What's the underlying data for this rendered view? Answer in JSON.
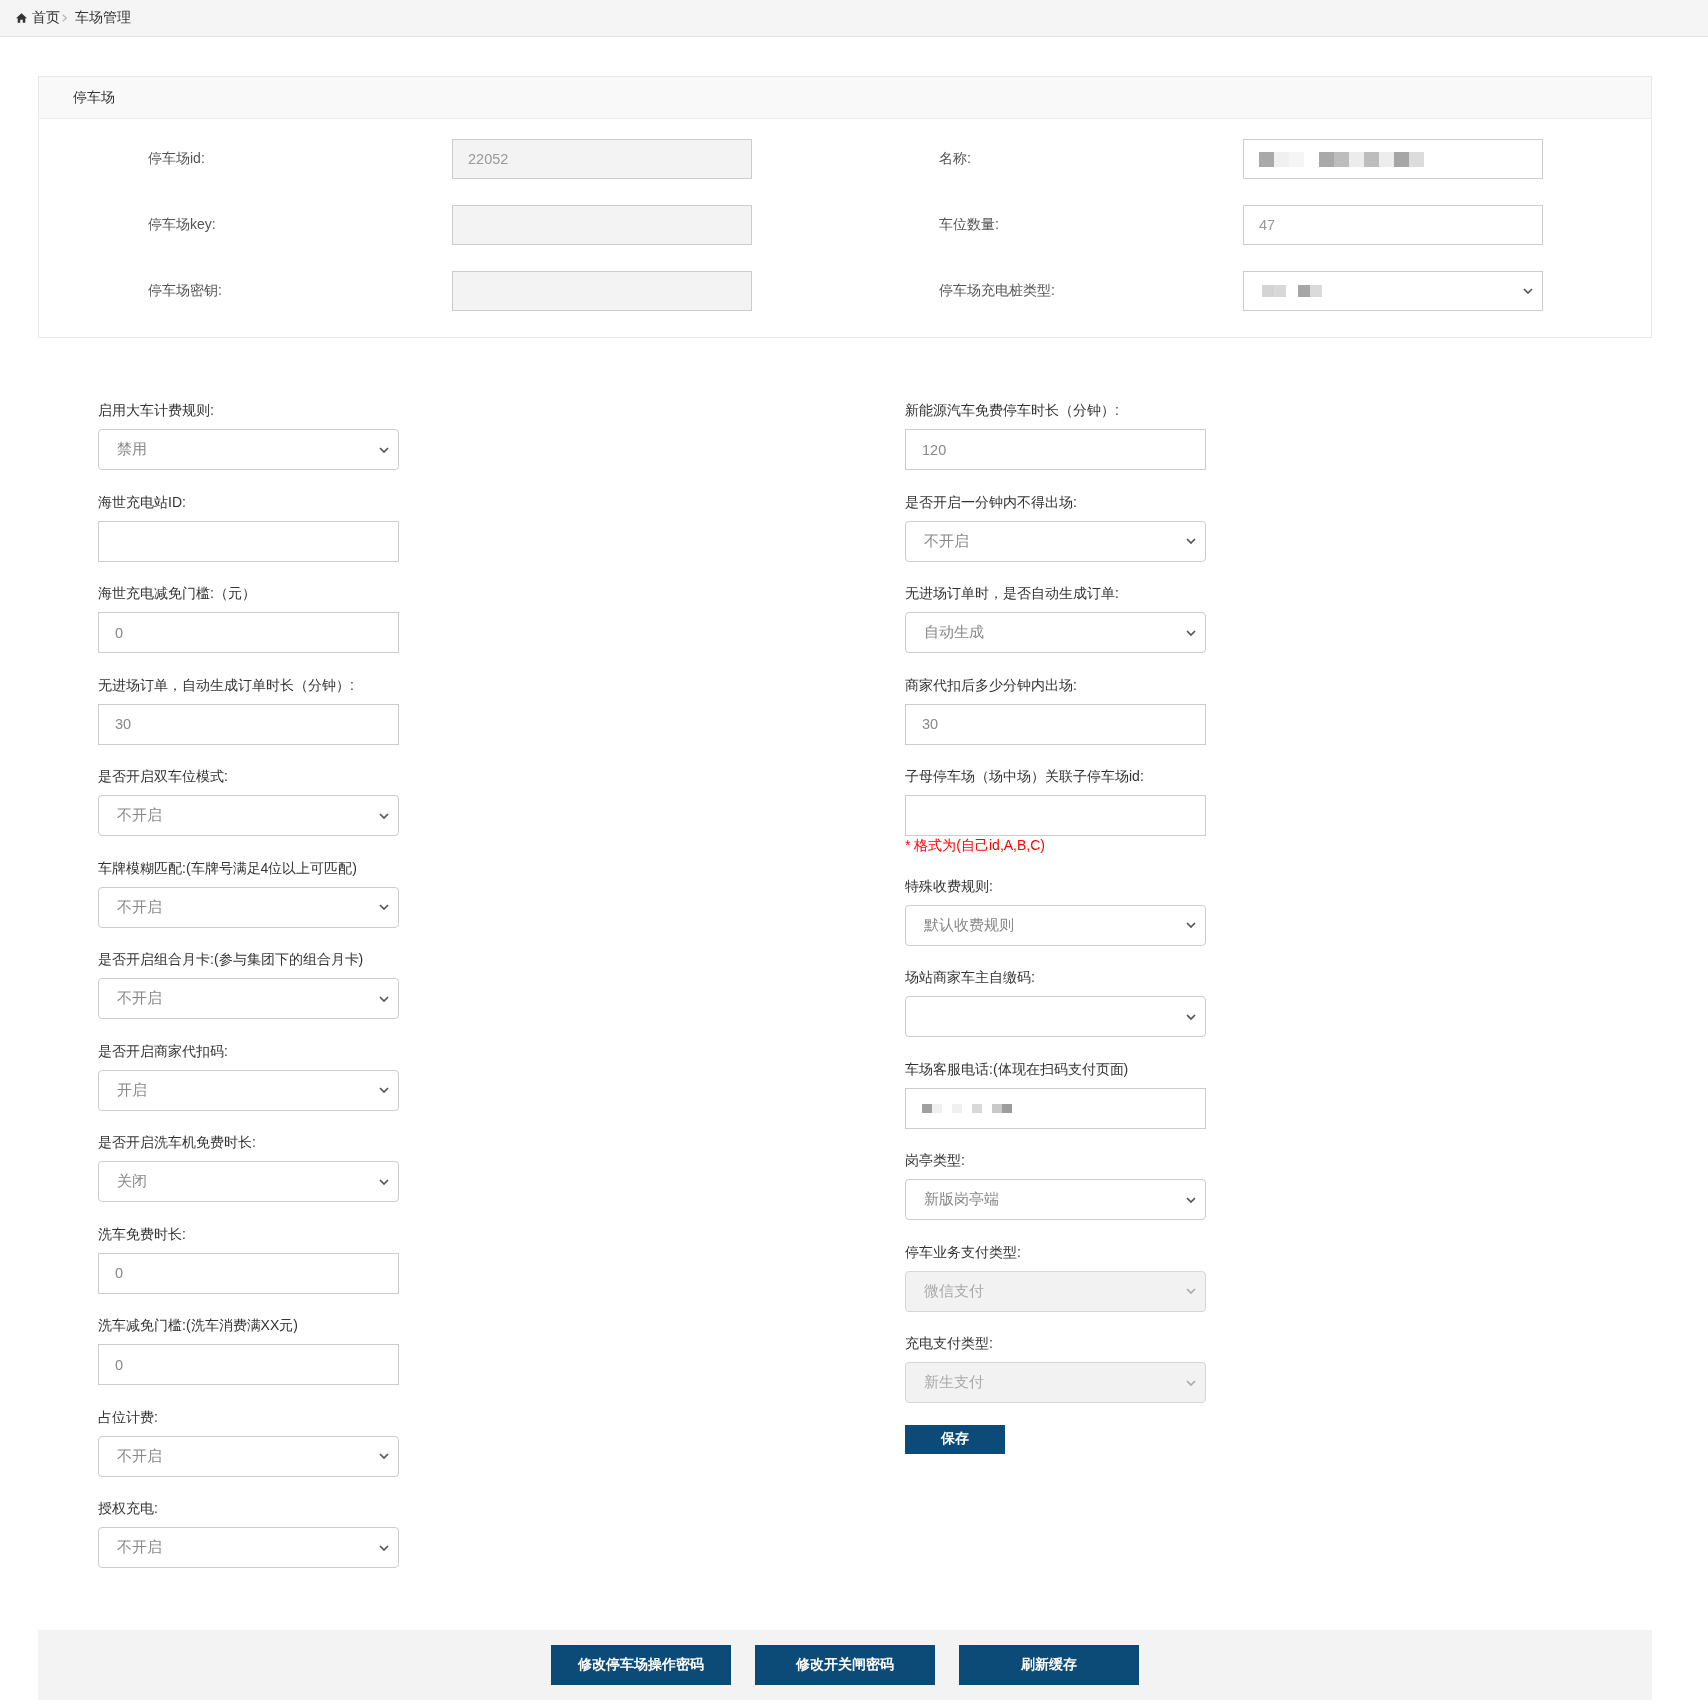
{
  "breadcrumb": {
    "items": [
      {
        "label": "首页",
        "kind": "home"
      },
      {
        "label": "车场管理",
        "kind": "page"
      }
    ]
  },
  "panel": {
    "title": "停车场",
    "fields": [
      {
        "label": "停车场id:",
        "kind": "input",
        "value": "22052",
        "disabled": true,
        "redacted": false
      },
      {
        "label": "名称:",
        "kind": "input",
        "disabled": false,
        "redacted": true
      },
      {
        "label": "停车场key:",
        "kind": "input",
        "disabled": true,
        "redacted": false
      },
      {
        "label": "车位数量:",
        "kind": "input",
        "value": "47",
        "disabled": false,
        "redacted": false
      },
      {
        "label": "停车场密钥:",
        "kind": "input",
        "disabled": true,
        "redacted": false
      },
      {
        "label": "停车场充电桩类型:",
        "kind": "select",
        "disabled": false,
        "redacted": true
      }
    ]
  },
  "form": {
    "left": [
      {
        "label": "启用大车计费规则:",
        "kind": "select",
        "value": "禁用",
        "disabled": false,
        "redacted": false
      },
      {
        "label": "海世充电站ID:",
        "kind": "input",
        "disabled": false,
        "redacted": false
      },
      {
        "label": "海世充电减免门槛:（元）",
        "kind": "input",
        "value": "0",
        "disabled": false,
        "redacted": false
      },
      {
        "label": "无进场订单，自动生成订单时长（分钟）:",
        "kind": "input",
        "value": "30",
        "disabled": false,
        "redacted": false
      },
      {
        "label": "是否开启双车位模式:",
        "kind": "select",
        "value": "不开启",
        "disabled": false,
        "redacted": false
      },
      {
        "label": "车牌模糊匹配:(车牌号满足4位以上可匹配)",
        "kind": "select",
        "value": "不开启",
        "disabled": false,
        "redacted": false
      },
      {
        "label": "是否开启组合月卡:(参与集团下的组合月卡)",
        "kind": "select",
        "value": "不开启",
        "disabled": false,
        "redacted": false
      },
      {
        "label": "是否开启商家代扣码:",
        "kind": "select",
        "value": "开启",
        "disabled": false,
        "redacted": false
      },
      {
        "label": "是否开启洗车机免费时长:",
        "kind": "select",
        "value": "关闭",
        "disabled": false,
        "redacted": false
      },
      {
        "label": "洗车免费时长:",
        "kind": "input",
        "value": "0",
        "disabled": false,
        "redacted": false
      },
      {
        "label": "洗车减免门槛:(洗车消费满XX元)",
        "kind": "input",
        "value": "0",
        "disabled": false,
        "redacted": false
      },
      {
        "label": "占位计费:",
        "kind": "select",
        "value": "不开启",
        "disabled": false,
        "redacted": false
      },
      {
        "label": "授权充电:",
        "kind": "select",
        "value": "不开启",
        "disabled": false,
        "redacted": false
      }
    ],
    "right": [
      {
        "label": "新能源汽车免费停车时长（分钟）:",
        "kind": "input",
        "value": "120",
        "disabled": false,
        "redacted": false
      },
      {
        "label": "是否开启一分钟内不得出场:",
        "kind": "select",
        "value": "不开启",
        "disabled": false,
        "redacted": false
      },
      {
        "label": "无进场订单时，是否自动生成订单:",
        "kind": "select",
        "value": "自动生成",
        "disabled": false,
        "redacted": false
      },
      {
        "label": "商家代扣后多少分钟内出场:",
        "kind": "input",
        "value": "30",
        "disabled": false,
        "redacted": false
      },
      {
        "label": "子母停车场（场中场）关联子停车场id:",
        "kind": "input",
        "disabled": false,
        "redacted": false,
        "note": "* 格式为(自己id,A,B,C)"
      },
      {
        "label": "特殊收费规则:",
        "kind": "select",
        "value": "默认收费规则",
        "disabled": false,
        "redacted": false
      },
      {
        "label": "场站商家车主自缴码:",
        "kind": "select",
        "disabled": false,
        "redacted": false
      },
      {
        "label": "车场客服电话:(体现在扫码支付页面)",
        "kind": "input",
        "disabled": false,
        "redacted": true
      },
      {
        "label": "岗亭类型:",
        "kind": "select",
        "value": "新版岗亭端",
        "disabled": false,
        "redacted": false
      },
      {
        "label": "停车业务支付类型:",
        "kind": "select",
        "value": "微信支付",
        "disabled": true,
        "redacted": false
      },
      {
        "label": "充电支付类型:",
        "kind": "select",
        "value": "新生支付",
        "disabled": true,
        "redacted": false
      }
    ],
    "save_button": "保存"
  },
  "actions": [
    {
      "label": "修改停车场操作密码"
    },
    {
      "label": "修改开关闸密码"
    },
    {
      "label": "刷新缓存"
    }
  ]
}
